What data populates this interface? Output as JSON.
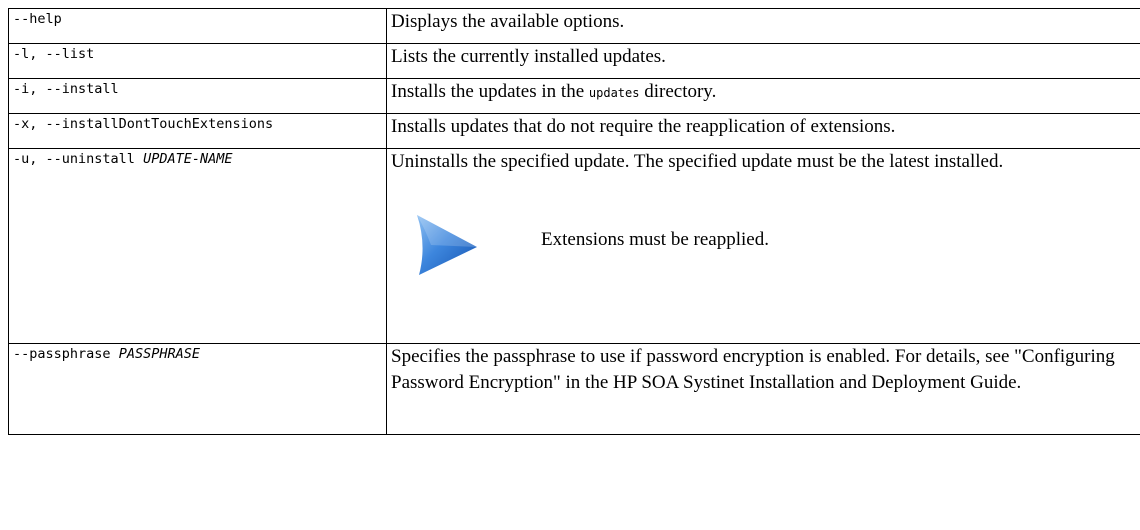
{
  "rows": [
    {
      "option": "--help",
      "description": "Displays the available options."
    },
    {
      "option": "-l, --list",
      "description": "Lists the currently installed updates."
    },
    {
      "option": "-i, --install",
      "description_before": "Installs the updates in the",
      "description_code": "updates",
      "description_after": "directory."
    },
    {
      "option": "-x, --installDontTouchExtensions",
      "description": "Installs updates that do not require the reapplication of extensions."
    },
    {
      "option": "-u, --uninstall",
      "option_arg": "UPDATE-NAME",
      "description": "Uninstalls the specified update. The specified update must be the latest installed.",
      "note": "Extensions must be reapplied.",
      "note_icon": "arrow-right-icon"
    },
    {
      "option": "--passphrase",
      "option_arg": "PASSPHRASE",
      "description": "Specifies the passphrase to use if password encryption is enabled. For details, see \"Configuring Password Encryption\" in the HP SOA Systinet Installation and Deployment Guide."
    }
  ],
  "colors": {
    "border": "#000000",
    "text": "#000000",
    "icon_light": "#7fb2ec",
    "icon_dark": "#1553b0"
  }
}
